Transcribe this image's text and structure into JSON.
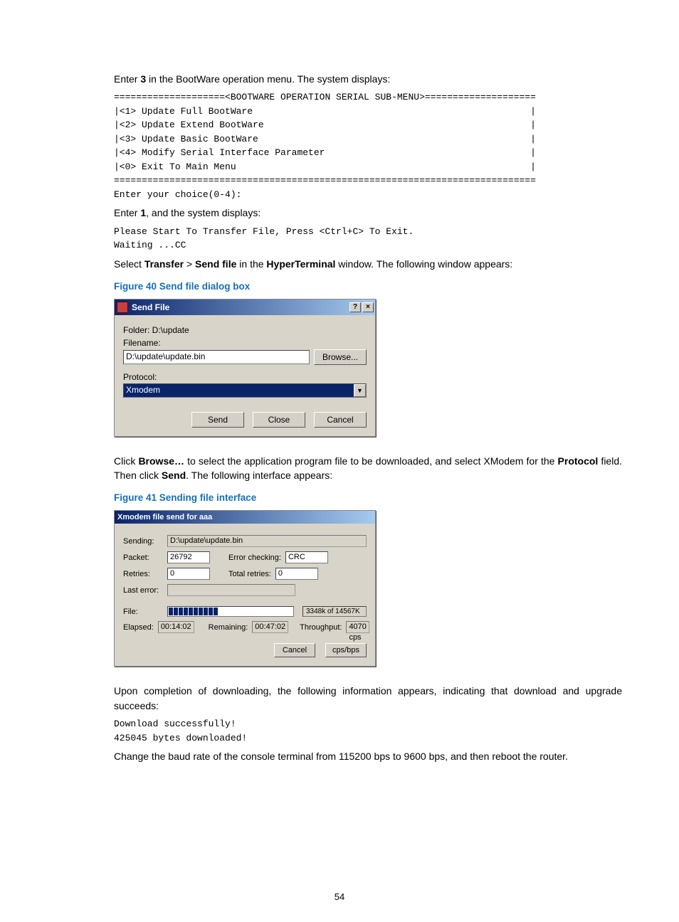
{
  "body": {
    "intro1_a": "Enter ",
    "intro1_b": "3",
    "intro1_c": " in the BootWare operation menu. The system displays:",
    "mono1": "====================<BOOTWARE OPERATION SERIAL SUB-MENU>====================\n|<1> Update Full BootWare                                                  |\n|<2> Update Extend BootWare                                                |\n|<3> Update Basic BootWare                                                 |\n|<4> Modify Serial Interface Parameter                                     |\n|<0> Exit To Main Menu                                                     |\n============================================================================\nEnter your choice(0-4):",
    "intro2_a": "Enter ",
    "intro2_b": "1",
    "intro2_c": ", and the system displays:",
    "mono2": "Please Start To Transfer File, Press <Ctrl+C> To Exit.\nWaiting ...CC",
    "intro3_a": "Select ",
    "intro3_b": "Transfer",
    "intro3_c": " > ",
    "intro3_d": "Send file",
    "intro3_e": " in the ",
    "intro3_f": "HyperTerminal",
    "intro3_g": " window. The following window appears:",
    "fig40": "Figure 40 Send file dialog box",
    "intro4_a": "Click ",
    "intro4_b": "Browse…",
    "intro4_c": " to select the application program file to be downloaded, and select XModem for the ",
    "intro4_d": "Protocol",
    "intro4_e": " field. Then click ",
    "intro4_f": "Send",
    "intro4_g": ". The following interface appears:",
    "fig41": "Figure 41 Sending file interface",
    "intro5": "Upon completion of downloading, the following information appears, indicating that download and upgrade succeeds:",
    "mono3": "Download successfully!\n425045 bytes downloaded!",
    "intro6": "Change the baud rate of the console terminal from 115200 bps to 9600 bps, and then reboot the router."
  },
  "dlg1": {
    "title": "Send File",
    "help": "?",
    "close": "×",
    "folder_lbl": "Folder: D:\\update",
    "filename_lbl": "Filename:",
    "filename_val": "D:\\update\\update.bin",
    "browse": "Browse...",
    "protocol_lbl": "Protocol:",
    "protocol_val": "Xmodem",
    "send": "Send",
    "close_btn": "Close",
    "cancel": "Cancel"
  },
  "dlg2": {
    "title": "Xmodem file send for aaa",
    "sending_lbl": "Sending:",
    "sending_val": "D:\\update\\update.bin",
    "packet_lbl": "Packet:",
    "packet_val": "26792",
    "errchk_lbl": "Error checking:",
    "errchk_val": "CRC",
    "retries_lbl": "Retries:",
    "retries_val": "0",
    "totretries_lbl": "Total retries:",
    "totretries_val": "0",
    "lasterr_lbl": "Last error:",
    "file_lbl": "File:",
    "file_prog_text": "3348k of 14567K",
    "elapsed_lbl": "Elapsed:",
    "elapsed_val": "00:14:02",
    "remaining_lbl": "Remaining:",
    "remaining_val": "00:47:02",
    "throughput_lbl": "Throughput:",
    "throughput_val": "4070 cps",
    "cancel": "Cancel",
    "cpsbps": "cps/bps"
  },
  "page_number": "54"
}
